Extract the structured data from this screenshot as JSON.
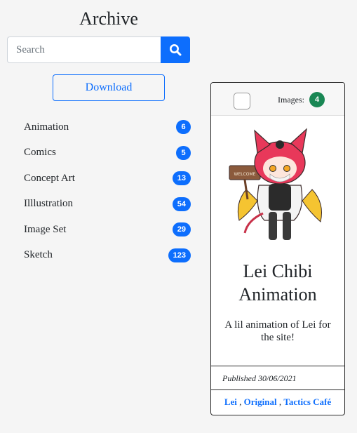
{
  "archive": {
    "title": "Archive",
    "search_placeholder": "Search",
    "search_icon": "search-icon",
    "download_label": "Download"
  },
  "categories": [
    {
      "label": "Animation",
      "count": "6"
    },
    {
      "label": "Comics",
      "count": "5"
    },
    {
      "label": "Concept Art",
      "count": "13"
    },
    {
      "label": "Illlustration",
      "count": "54"
    },
    {
      "label": "Image Set",
      "count": "29"
    },
    {
      "label": "Sketch",
      "count": "123"
    }
  ],
  "card": {
    "images_label": "Images:",
    "images_count": "4",
    "thumbnail_sign": "WELCOME",
    "title": "Lei Chibi Animation",
    "description": "A lil animation of Lei for the site!",
    "published": "Published 30/06/2021",
    "tags": [
      "Lei",
      "Original",
      "Tactics Café"
    ],
    "tag_separator": ","
  },
  "colors": {
    "accent": "#0d6efd",
    "success": "#198754",
    "background": "#f5f5f5"
  }
}
